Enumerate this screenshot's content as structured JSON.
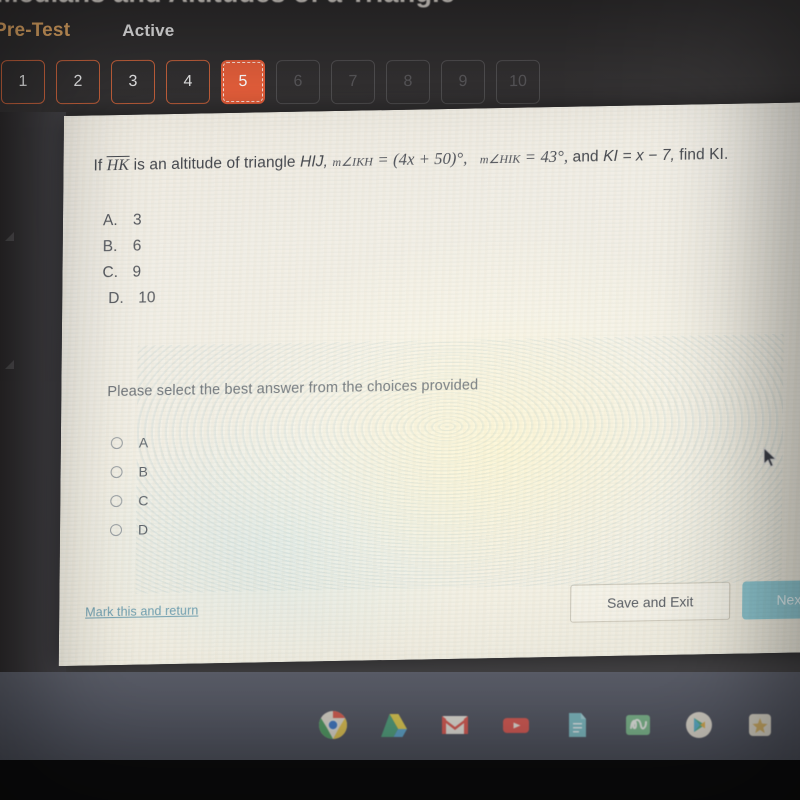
{
  "page": {
    "title": "Medians and Altitudes of a Triangle",
    "assignment_type": "Pre-Test",
    "assignment_state": "Active"
  },
  "question_nav": {
    "items": [
      {
        "number": "1",
        "state": "available"
      },
      {
        "number": "2",
        "state": "available"
      },
      {
        "number": "3",
        "state": "available"
      },
      {
        "number": "4",
        "state": "available"
      },
      {
        "number": "5",
        "state": "current"
      },
      {
        "number": "6",
        "state": "locked"
      },
      {
        "number": "7",
        "state": "locked"
      },
      {
        "number": "8",
        "state": "locked"
      },
      {
        "number": "9",
        "state": "locked"
      },
      {
        "number": "10",
        "state": "locked"
      }
    ]
  },
  "question": {
    "text_full": "If HK is an altitude of triangle HIJ, m∠IKH = (4x + 50)°, m∠HIK = 43°, and KI = x − 7, find KI.",
    "seg_if": "If",
    "seg_segment": "HK",
    "seg_mid": "is an altitude of triangle",
    "seg_triangle": "HIJ,",
    "seg_angle1_name": "m∠IKH",
    "seg_eq1": "=",
    "seg_angle1_value": "(4x + 50)°,",
    "seg_angle2_name": "m∠HIK",
    "seg_eq2": "=",
    "seg_angle2_value": "43°,",
    "seg_and": "and",
    "seg_side": "KI = x − 7,",
    "seg_find": "find KI.",
    "choices": [
      {
        "letter": "A.",
        "value": "3"
      },
      {
        "letter": "B.",
        "value": "6"
      },
      {
        "letter": "C.",
        "value": "9"
      },
      {
        "letter": "D.",
        "value": "10"
      }
    ],
    "prompt": "Please select the best answer from the choices provided",
    "options": [
      {
        "label": "A",
        "selected": false
      },
      {
        "label": "B",
        "selected": false
      },
      {
        "label": "C",
        "selected": false
      },
      {
        "label": "D",
        "selected": false
      }
    ]
  },
  "footer": {
    "mark_link": "Mark this and return",
    "save_button": "Save and Exit",
    "next_button": "Next"
  },
  "shelf": {
    "icons": [
      {
        "name": "chrome-icon",
        "glyph": "◉"
      },
      {
        "name": "google-drive-icon",
        "glyph": "▲"
      },
      {
        "name": "gmail-icon",
        "glyph": "✉"
      },
      {
        "name": "youtube-icon",
        "glyph": "▶"
      },
      {
        "name": "google-docs-icon",
        "glyph": "▤"
      },
      {
        "name": "jamboard-icon",
        "glyph": "✎"
      },
      {
        "name": "play-store-icon",
        "glyph": "▷"
      },
      {
        "name": "star-app-icon",
        "glyph": "✦"
      }
    ]
  },
  "colors": {
    "accent_orange": "#e8603c",
    "pretest_label": "#e0a765",
    "next_teal": "#8ec6d0",
    "link_teal": "#6f9fb0",
    "panel_bg": "#f1eee6"
  }
}
